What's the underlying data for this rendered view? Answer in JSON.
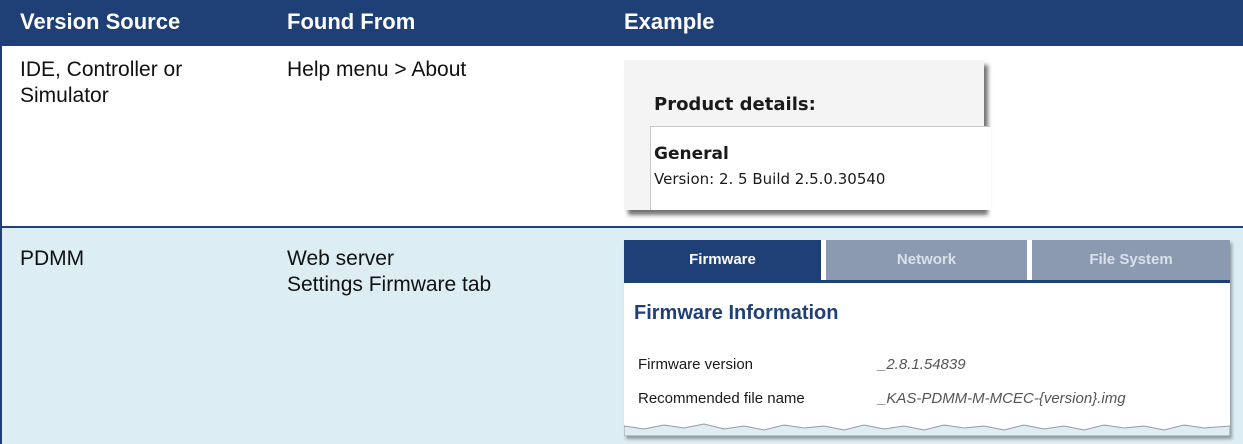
{
  "header": {
    "col1": "Version Source",
    "col2": "Found From",
    "col3": "Example"
  },
  "rows": [
    {
      "source": "IDE, Controller or Simulator",
      "found_from": "Help menu > About",
      "example": {
        "title": "Product details:",
        "section": "General",
        "version": "Version: 2. 5 Build 2.5.0.30540"
      }
    },
    {
      "source": "PDMM",
      "found_from_line1": "Web server",
      "found_from_line2": "Settings Firmware tab",
      "example": {
        "tabs": [
          "Firmware",
          "Network",
          "File System"
        ],
        "title": "Firmware Information",
        "firmware_label": "Firmware version",
        "firmware_value": "_2.8.1.54839",
        "file_label": "Recommended file name",
        "file_value": "_KAS-PDMM-M-MCEC-{version}.img"
      }
    }
  ],
  "colors": {
    "header_bg": "#1f3f77",
    "row_alt_bg": "#dcedf3",
    "tab_inactive": "#8b9ab1"
  }
}
